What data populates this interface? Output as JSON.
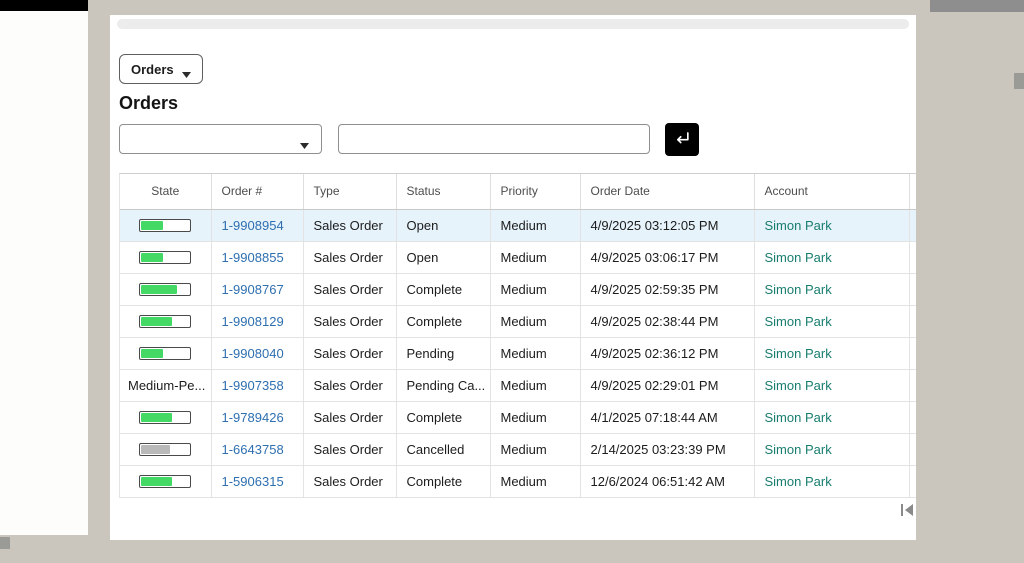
{
  "page": {
    "title": "Orders"
  },
  "toolbar": {
    "orders_button_label": "Orders"
  },
  "search": {
    "value": "",
    "placeholder": "",
    "combo_value": ""
  },
  "colors": {
    "link_blue": "#2e6fb0",
    "link_teal": "#177d6e",
    "bar_green": "#43d964",
    "bar_gray": "#b9b9b9",
    "row_highlight": "#e7f3fb"
  },
  "table": {
    "columns": [
      "State",
      "Order #",
      "Type",
      "Status",
      "Priority",
      "Order Date",
      "Account"
    ],
    "rows": [
      {
        "state": {
          "kind": "bar",
          "percent": 45,
          "color": "green"
        },
        "order_number": "1-9908954",
        "type": "Sales Order",
        "status": "Open",
        "priority": "Medium",
        "order_date": "4/9/2025 03:12:05 PM",
        "account": "Simon Park",
        "highlighted": true
      },
      {
        "state": {
          "kind": "bar",
          "percent": 45,
          "color": "green"
        },
        "order_number": "1-9908855",
        "type": "Sales Order",
        "status": "Open",
        "priority": "Medium",
        "order_date": "4/9/2025 03:06:17 PM",
        "account": "Simon Park",
        "highlighted": false
      },
      {
        "state": {
          "kind": "bar",
          "percent": 75,
          "color": "green"
        },
        "order_number": "1-9908767",
        "type": "Sales Order",
        "status": "Complete",
        "priority": "Medium",
        "order_date": "4/9/2025 02:59:35 PM",
        "account": "Simon Park",
        "highlighted": false
      },
      {
        "state": {
          "kind": "bar",
          "percent": 65,
          "color": "green"
        },
        "order_number": "1-9908129",
        "type": "Sales Order",
        "status": "Complete",
        "priority": "Medium",
        "order_date": "4/9/2025 02:38:44 PM",
        "account": "Simon Park",
        "highlighted": false
      },
      {
        "state": {
          "kind": "bar",
          "percent": 45,
          "color": "green"
        },
        "order_number": "1-9908040",
        "type": "Sales Order",
        "status": "Pending",
        "priority": "Medium",
        "order_date": "4/9/2025 02:36:12 PM",
        "account": "Simon Park",
        "highlighted": false
      },
      {
        "state": {
          "kind": "text",
          "text": "Medium-Pe..."
        },
        "order_number": "1-9907358",
        "type": "Sales Order",
        "status": "Pending Ca...",
        "priority": "Medium",
        "order_date": "4/9/2025 02:29:01 PM",
        "account": "Simon Park",
        "highlighted": false
      },
      {
        "state": {
          "kind": "bar",
          "percent": 65,
          "color": "green"
        },
        "order_number": "1-9789426",
        "type": "Sales Order",
        "status": "Complete",
        "priority": "Medium",
        "order_date": "4/1/2025 07:18:44 AM",
        "account": "Simon Park",
        "highlighted": false
      },
      {
        "state": {
          "kind": "bar",
          "percent": 60,
          "color": "gray"
        },
        "order_number": "1-6643758",
        "type": "Sales Order",
        "status": "Cancelled",
        "priority": "Medium",
        "order_date": "2/14/2025 03:23:39 PM",
        "account": "Simon Park",
        "highlighted": false
      },
      {
        "state": {
          "kind": "bar",
          "percent": 65,
          "color": "green"
        },
        "order_number": "1-5906315",
        "type": "Sales Order",
        "status": "Complete",
        "priority": "Medium",
        "order_date": "12/6/2024 06:51:42 AM",
        "account": "Simon Park",
        "highlighted": false
      }
    ]
  },
  "pagination": {
    "first_button": "go-to-first-page"
  }
}
